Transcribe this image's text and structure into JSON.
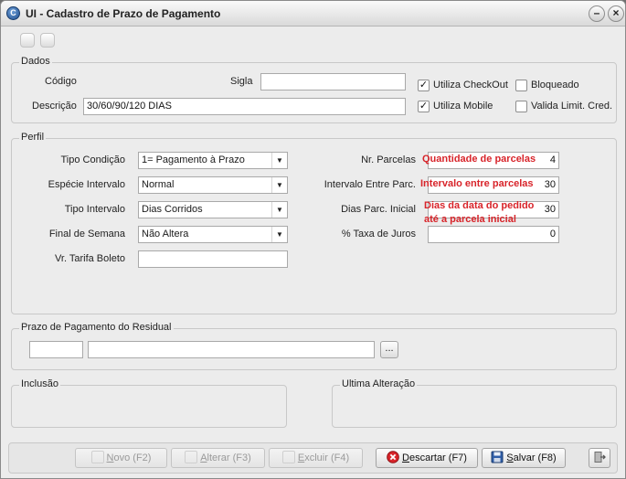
{
  "window": {
    "title": "UI - Cadastro de Prazo de Pagamento",
    "icon": "app-logo-icon"
  },
  "dados": {
    "title": "Dados",
    "codigo_label": "Código",
    "sigla_label": "Sigla",
    "sigla_value": "",
    "descricao_label": "Descrição",
    "descricao_value": "30/60/90/120 DIAS",
    "utiliza_checkout_label": "Utiliza CheckOut",
    "utiliza_checkout_checked": true,
    "bloqueado_label": "Bloqueado",
    "bloqueado_checked": false,
    "utiliza_mobile_label": "Utiliza Mobile",
    "utiliza_mobile_checked": true,
    "valida_limit_label": "Valida Limit. Cred.",
    "valida_limit_checked": false
  },
  "perfil": {
    "title": "Perfil",
    "tipo_condicao_label": "Tipo Condição",
    "tipo_condicao_value": "1= Pagamento à Prazo",
    "especie_intervalo_label": "Espécie Intervalo",
    "especie_intervalo_value": "Normal",
    "tipo_intervalo_label": "Tipo Intervalo",
    "tipo_intervalo_value": "Dias Corridos",
    "final_semana_label": "Final de Semana",
    "final_semana_value": "Não Altera",
    "vr_tarifa_label": "Vr. Tarifa Boleto",
    "vr_tarifa_value": "",
    "nr_parcelas_label": "Nr. Parcelas",
    "nr_parcelas_value": "4",
    "nr_parcelas_hint": "Quantidade de parcelas",
    "intervalo_label": "Intervalo Entre Parc.",
    "intervalo_value": "30",
    "intervalo_hint": "Intervalo entre parcelas",
    "dias_parc_label": "Dias Parc. Inicial",
    "dias_parc_value": "30",
    "dias_parc_hint_line1": "Dias da data do pedido",
    "dias_parc_hint_line2": "até a parcela inicial",
    "taxa_juros_label": "% Taxa de Juros",
    "taxa_juros_value": "0"
  },
  "residual": {
    "title": "Prazo de Pagamento do Residual",
    "code_value": "",
    "desc_value": "",
    "lookup_label": "..."
  },
  "inclusao": {
    "title": "Inclusão"
  },
  "ultima_alteracao": {
    "title": "Ultima Alteração"
  },
  "buttons": {
    "novo_pre": "",
    "novo_u": "N",
    "novo_post": "ovo (F2)",
    "alterar_pre": "",
    "alterar_u": "A",
    "alterar_post": "lterar (F3)",
    "excluir_pre": "",
    "excluir_u": "E",
    "excluir_post": "xcluir (F4)",
    "descartar_pre": "",
    "descartar_u": "D",
    "descartar_post": "escartar (F7)",
    "salvar_pre": "",
    "salvar_u": "S",
    "salvar_post": "alvar (F8)"
  },
  "colors": {
    "hint": "#d8242a",
    "accent": "#1f4f8f"
  }
}
